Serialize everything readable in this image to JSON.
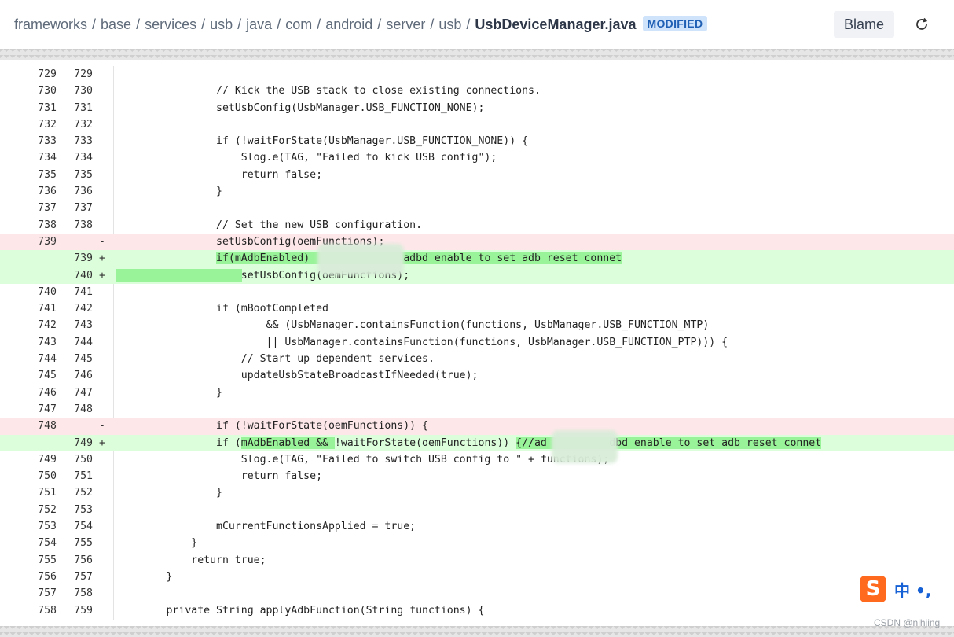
{
  "breadcrumb": {
    "segments": [
      "frameworks",
      "base",
      "services",
      "usb",
      "java",
      "com",
      "android",
      "server",
      "usb"
    ],
    "separator": "/",
    "file": "UsbDeviceManager.java",
    "badge": "MODIFIED"
  },
  "toolbar": {
    "blame_label": "Blame",
    "refresh_icon": "refresh-icon"
  },
  "colors": {
    "deleted_bg": "#fde7e9",
    "added_bg": "#dcfedb",
    "highlight": "#99f399",
    "badge_bg": "#cfe3fb",
    "badge_fg": "#1f5fb4"
  },
  "lines": [
    {
      "type": "ctx",
      "old": "729",
      "new": "729",
      "marker": "",
      "code": ""
    },
    {
      "type": "ctx",
      "old": "730",
      "new": "730",
      "marker": "",
      "code": "                // Kick the USB stack to close existing connections."
    },
    {
      "type": "ctx",
      "old": "731",
      "new": "731",
      "marker": "",
      "code": "                setUsbConfig(UsbManager.USB_FUNCTION_NONE);"
    },
    {
      "type": "ctx",
      "old": "732",
      "new": "732",
      "marker": "",
      "code": ""
    },
    {
      "type": "ctx",
      "old": "733",
      "new": "733",
      "marker": "",
      "code": "                if (!waitForState(UsbManager.USB_FUNCTION_NONE)) {"
    },
    {
      "type": "ctx",
      "old": "734",
      "new": "734",
      "marker": "",
      "code": "                    Slog.e(TAG, \"Failed to kick USB config\");"
    },
    {
      "type": "ctx",
      "old": "735",
      "new": "735",
      "marker": "",
      "code": "                    return false;"
    },
    {
      "type": "ctx",
      "old": "736",
      "new": "736",
      "marker": "",
      "code": "                }"
    },
    {
      "type": "ctx",
      "old": "737",
      "new": "737",
      "marker": "",
      "code": ""
    },
    {
      "type": "ctx",
      "old": "738",
      "new": "738",
      "marker": "",
      "code": "                // Set the new USB configuration."
    },
    {
      "type": "del",
      "old": "739",
      "new": "",
      "marker": "-",
      "code": "                setUsbConfig(oemFunctions);"
    },
    {
      "type": "add",
      "old": "",
      "new": "739",
      "marker": "+",
      "code": "                if(mAdbEnabled)               adbd enable to set adb reset connet"
    },
    {
      "type": "add",
      "old": "",
      "new": "740",
      "marker": "+",
      "code": "                    setUsbConfig(oemFunctions);"
    },
    {
      "type": "ctx",
      "old": "740",
      "new": "741",
      "marker": "",
      "code": ""
    },
    {
      "type": "ctx",
      "old": "741",
      "new": "742",
      "marker": "",
      "code": "                if (mBootCompleted"
    },
    {
      "type": "ctx",
      "old": "742",
      "new": "743",
      "marker": "",
      "code": "                        && (UsbManager.containsFunction(functions, UsbManager.USB_FUNCTION_MTP)"
    },
    {
      "type": "ctx",
      "old": "743",
      "new": "744",
      "marker": "",
      "code": "                        || UsbManager.containsFunction(functions, UsbManager.USB_FUNCTION_PTP))) {"
    },
    {
      "type": "ctx",
      "old": "744",
      "new": "745",
      "marker": "",
      "code": "                    // Start up dependent services."
    },
    {
      "type": "ctx",
      "old": "745",
      "new": "746",
      "marker": "",
      "code": "                    updateUsbStateBroadcastIfNeeded(true);"
    },
    {
      "type": "ctx",
      "old": "746",
      "new": "747",
      "marker": "",
      "code": "                }"
    },
    {
      "type": "ctx",
      "old": "747",
      "new": "748",
      "marker": "",
      "code": ""
    },
    {
      "type": "del",
      "old": "748",
      "new": "",
      "marker": "-",
      "code": "                if (!waitForState(oemFunctions)) {"
    },
    {
      "type": "add",
      "old": "",
      "new": "749",
      "marker": "+",
      "code": "                if (mAdbEnabled && !waitForState(oemFunctions)) {//ad          dbd enable to set adb reset connet"
    },
    {
      "type": "ctx",
      "old": "749",
      "new": "750",
      "marker": "",
      "code": "                    Slog.e(TAG, \"Failed to switch USB config to \" + functions);"
    },
    {
      "type": "ctx",
      "old": "750",
      "new": "751",
      "marker": "",
      "code": "                    return false;"
    },
    {
      "type": "ctx",
      "old": "751",
      "new": "752",
      "marker": "",
      "code": "                }"
    },
    {
      "type": "ctx",
      "old": "752",
      "new": "753",
      "marker": "",
      "code": ""
    },
    {
      "type": "ctx",
      "old": "753",
      "new": "754",
      "marker": "",
      "code": "                mCurrentFunctionsApplied = true;"
    },
    {
      "type": "ctx",
      "old": "754",
      "new": "755",
      "marker": "",
      "code": "            }"
    },
    {
      "type": "ctx",
      "old": "755",
      "new": "756",
      "marker": "",
      "code": "            return true;"
    },
    {
      "type": "ctx",
      "old": "756",
      "new": "757",
      "marker": "",
      "code": "        }"
    },
    {
      "type": "ctx",
      "old": "757",
      "new": "758",
      "marker": "",
      "code": ""
    },
    {
      "type": "ctx",
      "old": "758",
      "new": "759",
      "marker": "",
      "code": "        private String applyAdbFunction(String functions) {"
    }
  ],
  "ime": {
    "logo": "S",
    "text": "中 •,"
  },
  "watermark": "CSDN @nihjing"
}
